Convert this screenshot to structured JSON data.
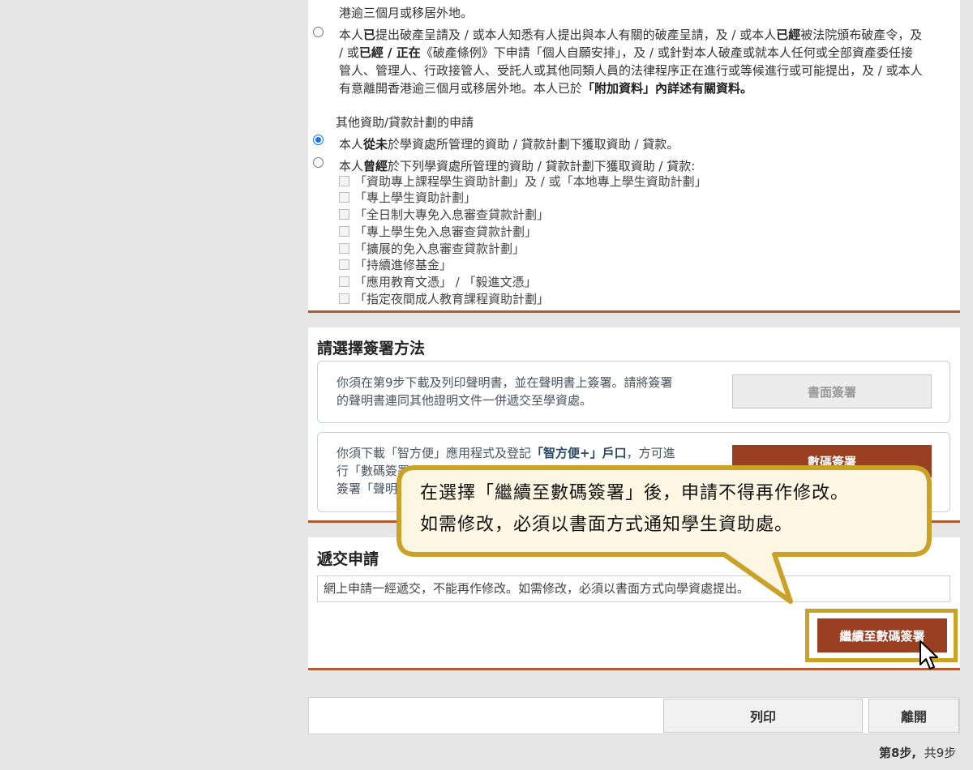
{
  "bankruptcy": {
    "cut_line": "港逾三個月或移居外地。",
    "option2": {
      "t1": "本人",
      "b1": "已",
      "t2": "提出破產呈請及 / 或本人知悉有人提出與本人有關的破產呈請，及 / 或本人",
      "b2": "已經",
      "t3": "被法院頒布破產令，及",
      "t4": "/ 或",
      "b3": "已經 / 正在",
      "t5": "《破產條例》下申請「個人自願安排」，及 / 或針對本人破產或就本人任何或全部資產委任接",
      "line3": "管人、管理人、行政接管人、受託人或其他同類人員的法律程序正在進行或等候進行或可能提出，及 / 或本人",
      "t6": "有意離開香港逾三個月或移居外地。本人已於",
      "b4": "「附加資料」內詳述有關資料。"
    }
  },
  "other_aid": {
    "heading": "其他資助/貸款計劃的申請",
    "never": {
      "t1": "本人",
      "b1": "從未",
      "t2": "於學資處所管理的資助 / 貸款計劃下獲取資助 / 貸款。"
    },
    "ever": {
      "t1": "本人",
      "b1": "曾經",
      "t2": "於下列學資處所管理的資助 / 貸款計劃下獲取資助 / 貸款:"
    },
    "schemes": [
      "「資助專上課程學生資助計劃」及 / 或「本地專上學生資助計劃」",
      "「專上學生資助計劃」",
      "「全日制大專免入息審查貸款計劃」",
      "「專上學生免入息審查貸款計劃」",
      "「擴展的免入息審查貸款計劃」",
      "「持續進修基金」",
      "「應用教育文憑」 / 「毅進文憑」",
      "「指定夜間成人教育課程資助計劃」"
    ]
  },
  "signing": {
    "title": "請選擇簽署方法",
    "paper_text_1": "你須在第9步下載及列印聲明書，並在聲明書上簽署。請將簽署",
    "paper_text_2": "的聲明書連同其他證明文件一併遞交至學資處。",
    "paper_button": "書面簽署",
    "digital_text_1a": "你須下載「智方便」應用程式及登記",
    "digital_text_1b": "「智方便+」戶口",
    "digital_text_1c": "，方可進",
    "digital_text_2": "行「數碼簽署",
    "digital_text_3": "簽署「聲明",
    "digital_button": "數碼簽署"
  },
  "submit": {
    "title": "遞交申請",
    "notice": "網上申請一經遞交，不能再作修改。如需修改，必須以書面方式向學資處提出。",
    "continue_button": "繼續至數碼簽署"
  },
  "callout": {
    "line1": "在選擇「繼續至數碼簽署」後，申請不得再作修改。",
    "line2": "如需修改，必須以書面方式通知學生資助處。"
  },
  "footer": {
    "print_button": "列印",
    "exit_button": "離開",
    "step_current": "第8步,",
    "step_total": "共9步"
  },
  "colors": {
    "accent": "#9a3f22",
    "divider": "#b05a34",
    "callout_border": "#c9a227",
    "callout_fill": "#fdf6e3"
  }
}
